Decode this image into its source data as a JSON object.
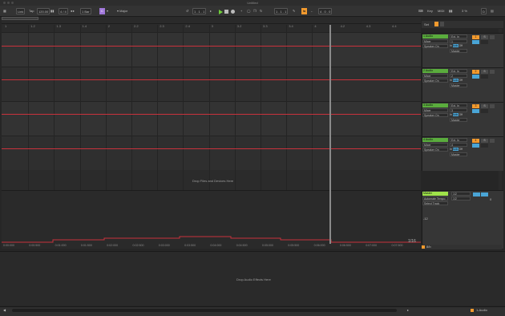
{
  "window": {
    "title": "Untitled"
  },
  "transport": {
    "link": "Link",
    "tap": "Tap",
    "tempo": "120.00",
    "signature": "4 / 4",
    "metronome": "●●",
    "quantize": "1 Bar",
    "key_badge": "C",
    "scale": "Major",
    "position": "1 . 1 . 1",
    "loop_start": "1 . 1 . 1",
    "loop_len": "4 . 0 . 0",
    "key": "Key",
    "midi": "MIDI",
    "cpu": "3 %",
    "d_badge": "D"
  },
  "ruler": {
    "bars": [
      "1",
      "1.2",
      "1.3",
      "1.4",
      "2",
      "2.2",
      "2.3",
      "2.4",
      "3",
      "3.2",
      "3.3",
      "3.4",
      "4",
      "4.2",
      "4.3",
      "4.4"
    ]
  },
  "colors": {
    "track_green": "#5aac3d",
    "master_green": "#9fe34a",
    "automation_red": "#c8323c",
    "accent_orange": "#f29a2e",
    "accent_blue": "#4aa5d6"
  },
  "tracks": [
    {
      "name": "1 Audio",
      "input_type": "Ext. In",
      "input_channel": "1",
      "monitor": "Speaker On",
      "monitor_in": "In",
      "monitor_auto": "Auto",
      "monitor_off": "Off",
      "output": "Master",
      "number": "1",
      "solo": "S"
    },
    {
      "name": "2 Audio",
      "input_type": "Ext. In",
      "input_channel": "2",
      "monitor": "Speaker On",
      "monitor_in": "In",
      "monitor_auto": "Auto",
      "monitor_off": "Off",
      "output": "Master",
      "number": "2",
      "solo": "S"
    },
    {
      "name": "3 Audio",
      "input_type": "Ext. In",
      "input_channel": "3",
      "monitor": "Speaker On",
      "monitor_in": "In",
      "monitor_auto": "Auto",
      "monitor_off": "Off",
      "output": "Master",
      "number": "3",
      "solo": "S"
    },
    {
      "name": "4 Audio",
      "input_type": "Ext. In",
      "input_channel": "4",
      "monitor": "Speaker On",
      "monitor_in": "In",
      "monitor_auto": "Auto",
      "monitor_off": "Off",
      "output": "Master",
      "number": "4",
      "solo": "S"
    }
  ],
  "track_param": "Mixer",
  "master": {
    "name": "Master",
    "automation": "Automate Tempo",
    "output": "1/2",
    "output2": "1/2",
    "sub": "Select Track",
    "db": "0",
    "vol_label": "-12"
  },
  "drop_files": "Drop Files and Devices Here",
  "drop_effects": "Drop Audio Effects Here",
  "loop_counter": "1/16",
  "times": [
    "0:00:000",
    "0:00:500",
    "0:01:000",
    "0:01:500",
    "0:02:000",
    "0:02:500",
    "0:03:000",
    "0:03:500",
    "0:04:000",
    "0:04:500",
    "0:05:000",
    "0:05:500",
    "0:06:000",
    "0:06:500",
    "0:07:000",
    "0:07:500"
  ],
  "zoom": "8/b",
  "status": {
    "track": "1-Audio"
  }
}
